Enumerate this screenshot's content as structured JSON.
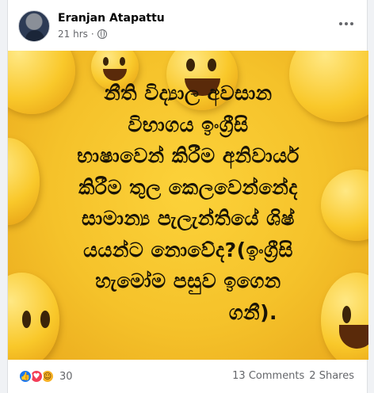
{
  "post": {
    "author": "Eranjan Atapattu",
    "time": "21 hrs",
    "privacy_icon": "globe-icon",
    "more_icon": "more-options-icon",
    "image_text_lines": [
      "නීති විද්‍යාල අවසාන",
      "විභාගය ඉංග්‍රීසි",
      "භාෂාවෙන් කිරීම අනිවාර්ය",
      "කිරීම තුල කෙලවෙන්නේද",
      "සාමාන්‍ය පැලැන්තියේ ශිෂ්",
      "යයන්ට නොවේද?(ඉංග්‍රීසි",
      "හැමෝම පසුව ඉගෙන",
      "ගනී)."
    ],
    "reactions": {
      "icons": [
        "like-icon",
        "love-icon",
        "haha-icon"
      ],
      "count": "30"
    },
    "comments": "13 Comments",
    "shares": "2 Shares"
  },
  "colors": {
    "background_yellow": "#f5c22a",
    "like_blue": "#1877f2",
    "love_red": "#f33e58"
  }
}
